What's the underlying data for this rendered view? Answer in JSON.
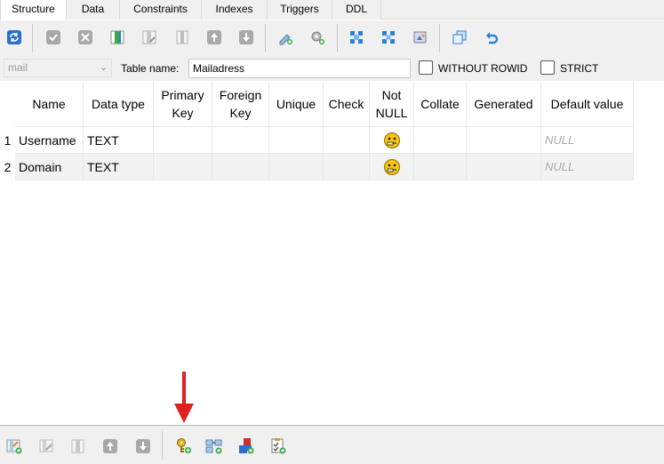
{
  "tabs": [
    {
      "label": "Structure",
      "active": true
    },
    {
      "label": "Data",
      "active": false
    },
    {
      "label": "Constraints",
      "active": false
    },
    {
      "label": "Indexes",
      "active": false
    },
    {
      "label": "Triggers",
      "active": false
    },
    {
      "label": "DDL",
      "active": false
    }
  ],
  "toolbar": {
    "icons": [
      "refresh-icon",
      "commit-icon",
      "rollback-icon",
      "add-column-icon",
      "edit-column-icon",
      "delete-column-icon",
      "move-up-icon",
      "move-down-icon",
      "add-primary-key-icon",
      "add-foreign-key-icon",
      "add-unique-icon",
      "add-check-icon",
      "export-icon",
      "create-similar-icon",
      "undo-icon"
    ]
  },
  "namerow": {
    "schema_value": "mail",
    "table_name_label": "Table name:",
    "table_name_value": "Mailadress",
    "without_rowid_label": "WITHOUT ROWID",
    "strict_label": "STRICT"
  },
  "grid": {
    "headers": [
      [
        "Name"
      ],
      [
        "Data type"
      ],
      [
        "Primary",
        "Key"
      ],
      [
        "Foreign",
        "Key"
      ],
      [
        "Unique"
      ],
      [
        "Check"
      ],
      [
        "Not",
        "NULL"
      ],
      [
        "Collate"
      ],
      [
        "Generated"
      ],
      [
        "Default value"
      ]
    ],
    "rows": [
      {
        "num": "1",
        "name": "Username",
        "type": "TEXT",
        "not_null": true,
        "default": "NULL"
      },
      {
        "num": "2",
        "name": "Domain",
        "type": "TEXT",
        "not_null": true,
        "default": "NULL"
      }
    ]
  },
  "colors": {
    "arrow": "#e02020",
    "toolbar_bg": "#f0f0f0",
    "icon_blue": "#2a7fd6",
    "icon_green": "#3aa84a",
    "icon_gray": "#a8a8a8"
  }
}
